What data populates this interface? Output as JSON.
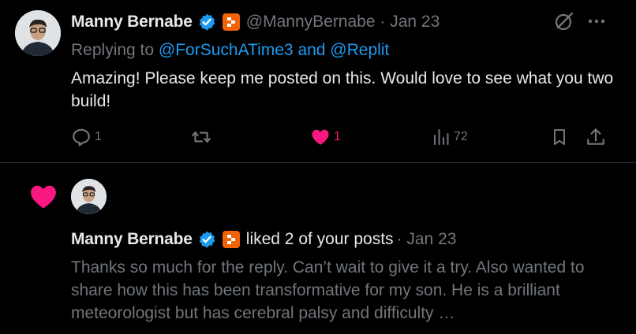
{
  "tweet": {
    "author_name": "Manny Bernabe",
    "handle": "@MannyBernabe",
    "separator": "·",
    "date": "Jan 23",
    "replying_prefix": "Replying to",
    "replying_users": "@ForSuchATime3 and @Replit",
    "text": "Amazing! Please keep me posted on this. Would love to see what you two build!",
    "replies_count": "1",
    "likes_count": "1",
    "views_count": "72"
  },
  "notification": {
    "author_name": "Manny Bernabe",
    "action_text": "liked 2 of your posts",
    "date": "· Jan 23",
    "preview": "Thanks so much for the reply. Can’t wait to give it a try.  Also wanted to share how this has been transformative for my son. He is a brilliant meteorologist but has cerebral palsy and difficulty …"
  },
  "colors": {
    "background": "#000000",
    "primary_text": "#e7e9ea",
    "secondary_text": "#71767b",
    "link": "#1d9bf0",
    "like": "#f91880",
    "verified": "#1d9bf0",
    "affiliate_badge": "#f26207"
  },
  "icons": [
    "verified-icon",
    "affiliate-badge-icon",
    "grok-icon",
    "more-icon",
    "reply-icon",
    "retweet-icon",
    "like-icon",
    "views-icon",
    "bookmark-icon",
    "share-icon",
    "notification-heart-icon"
  ]
}
